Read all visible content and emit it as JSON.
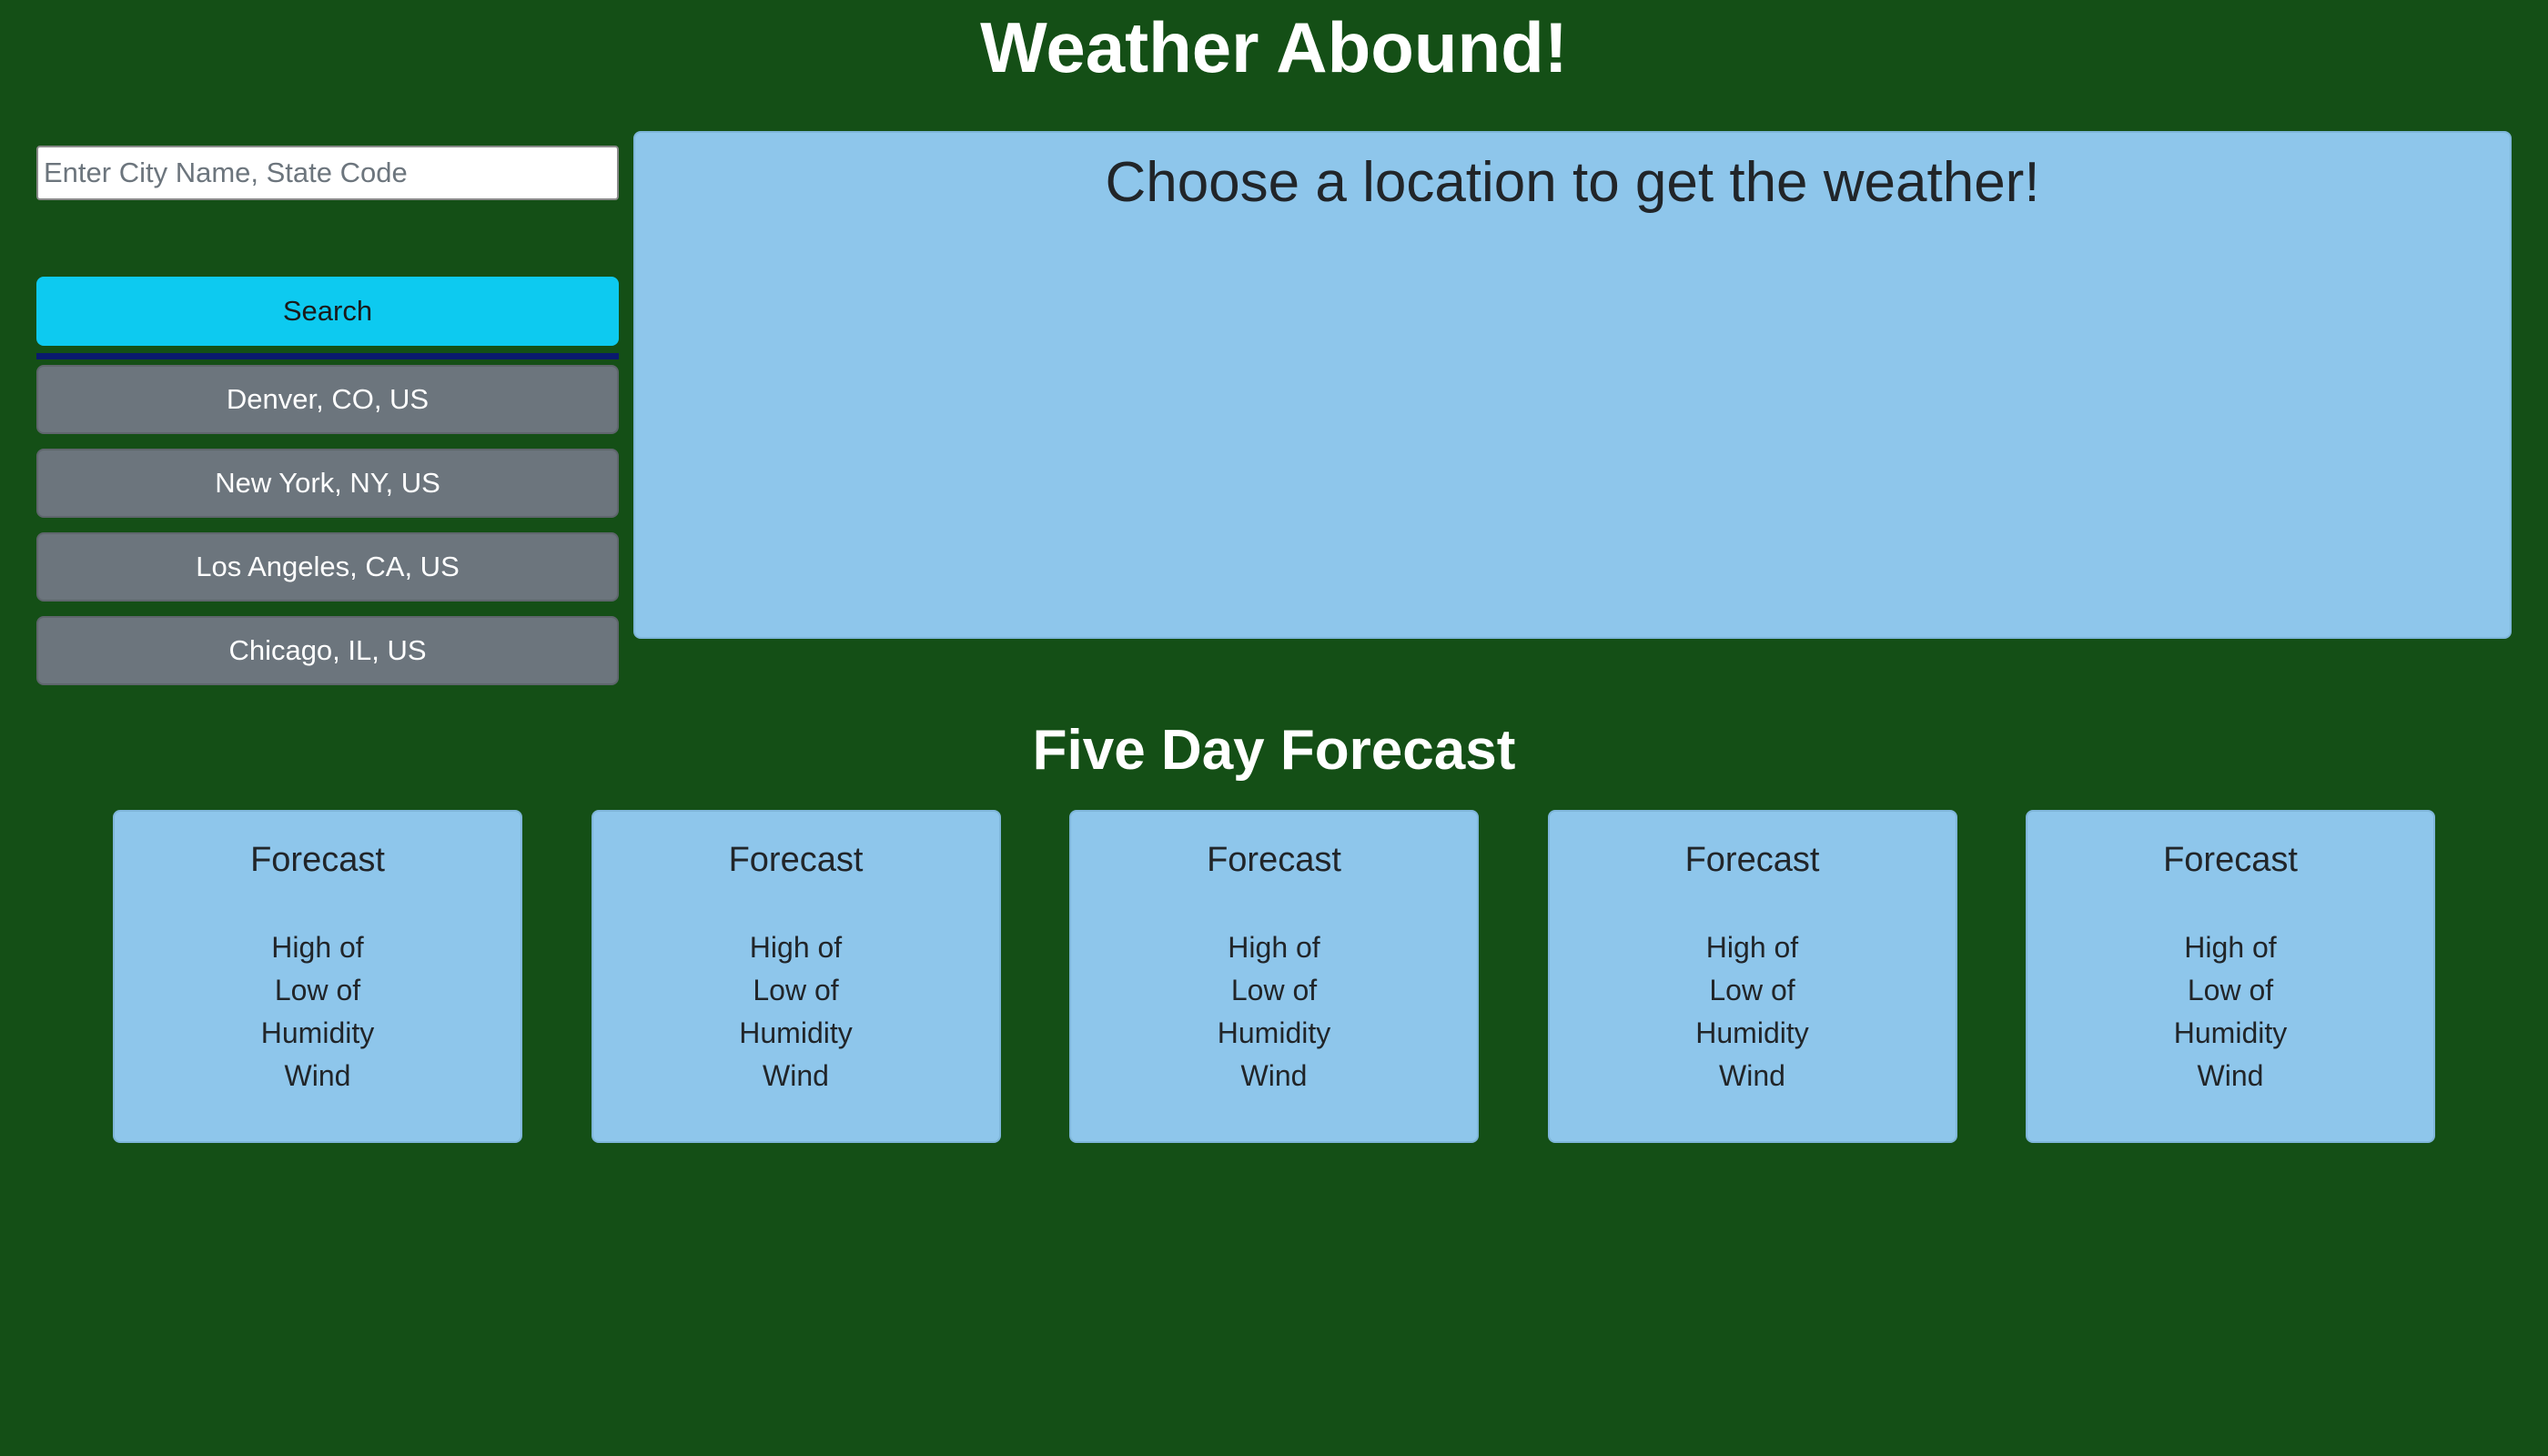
{
  "header": {
    "title": "Weather Abound!"
  },
  "sidebar": {
    "search_placeholder": "Enter City Name, State Code",
    "search_value": "",
    "search_button_label": "Search",
    "history": [
      {
        "label": "Denver, CO, US"
      },
      {
        "label": "New York, NY, US"
      },
      {
        "label": "Los Angeles, CA, US"
      },
      {
        "label": "Chicago, IL, US"
      }
    ]
  },
  "current": {
    "heading": "Choose a location to get the weather!"
  },
  "forecast": {
    "heading": "Five Day Forecast",
    "cards": [
      {
        "title": "Forecast",
        "high": "High of",
        "low": "Low of",
        "humidity": "Humidity",
        "wind": "Wind"
      },
      {
        "title": "Forecast",
        "high": "High of",
        "low": "Low of",
        "humidity": "Humidity",
        "wind": "Wind"
      },
      {
        "title": "Forecast",
        "high": "High of",
        "low": "Low of",
        "humidity": "Humidity",
        "wind": "Wind"
      },
      {
        "title": "Forecast",
        "high": "High of",
        "low": "Low of",
        "humidity": "Humidity",
        "wind": "Wind"
      },
      {
        "title": "Forecast",
        "high": "High of",
        "low": "Low of",
        "humidity": "Humidity",
        "wind": "Wind"
      }
    ]
  },
  "colors": {
    "background": "#144f16",
    "panel": "#8ec6eb",
    "search_button": "#0dcaf0",
    "history_button": "#6c757d",
    "divider": "#0a1a6e"
  }
}
